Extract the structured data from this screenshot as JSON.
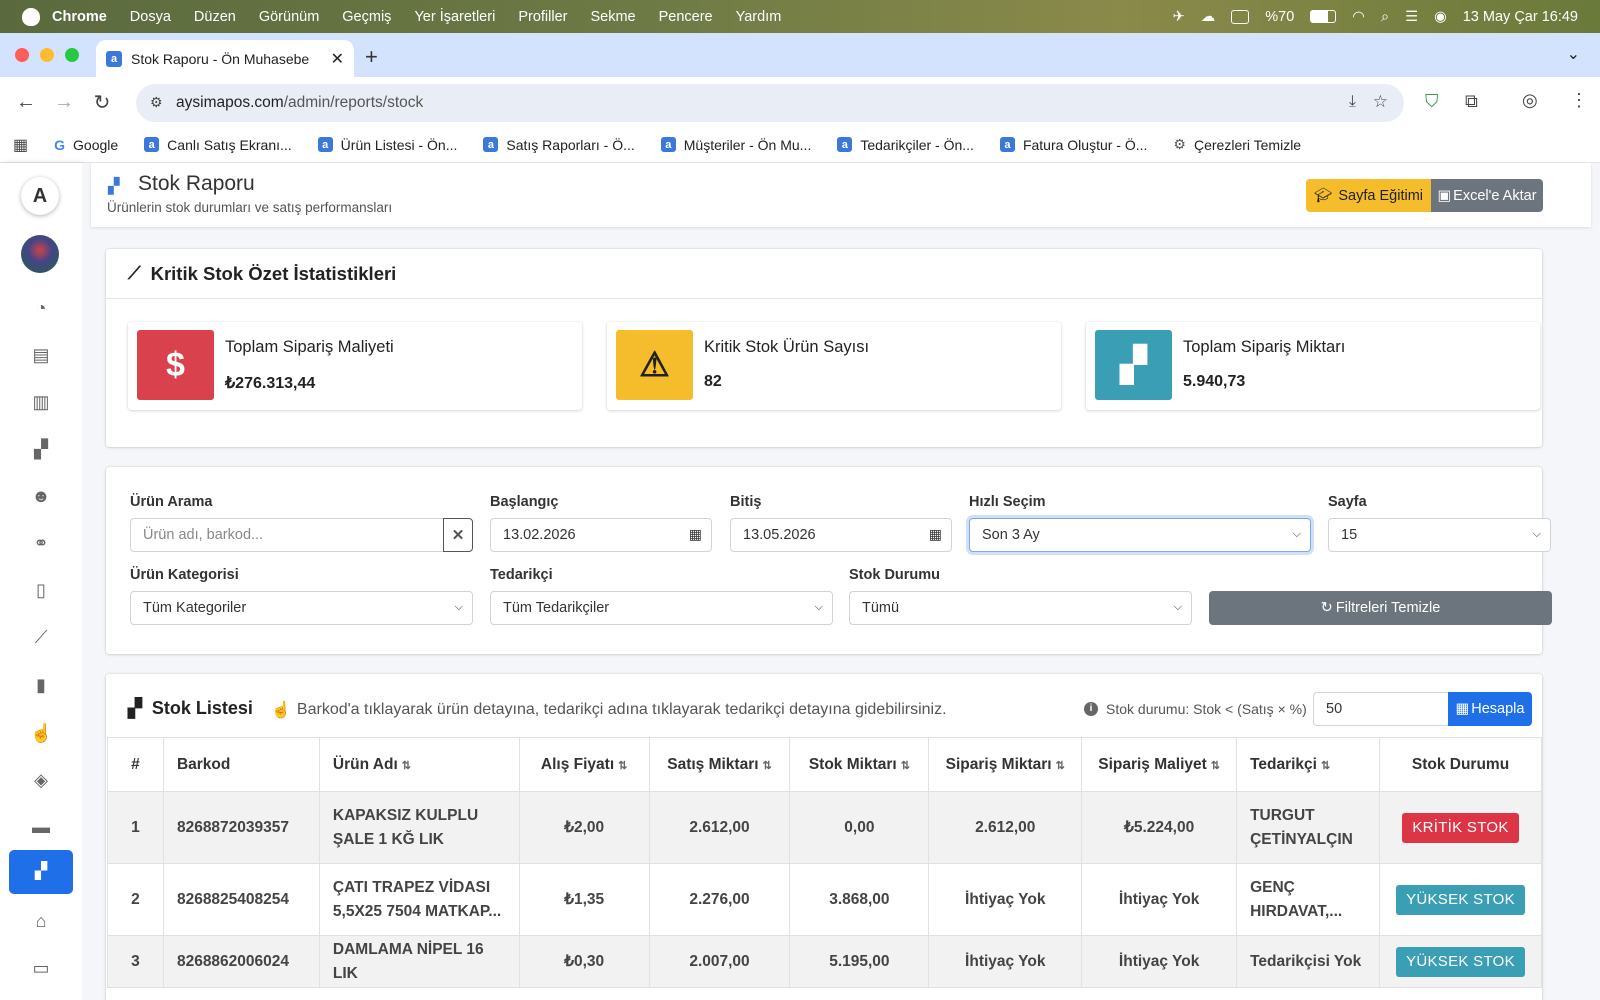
{
  "os_menubar": {
    "app": "Chrome",
    "items": [
      "Dosya",
      "Düzen",
      "Görünüm",
      "Geçmiş",
      "Yer İşaretleri",
      "Profiller",
      "Sekme",
      "Pencere",
      "Yardım"
    ],
    "battery": "%70",
    "datetime": "13 May Çar  16:49"
  },
  "browser": {
    "tab_title": "Stok Raporu - Ön Muhasebe",
    "url_host": "aysimapos.com",
    "url_path": "/admin/reports/stock",
    "bookmarks": [
      "Google",
      "Canlı Satış Ekranı...",
      "Ürün Listesi - Ön...",
      "Satış Raporları - Ö...",
      "Müşteriler - Ön Mu...",
      "Tedarikçiler - Ön...",
      "Fatura Oluştur - Ö...",
      "Çerezleri Temizle"
    ]
  },
  "header": {
    "title": "Stok Raporu",
    "subtitle": "Ürünlerin stok durumları ve satış performansları",
    "training_button": "Sayfa Eğitimi",
    "excel_button": "Excel'e Aktar"
  },
  "summary": {
    "title": "Kritik Stok Özet İstatistikleri",
    "boxes": [
      {
        "label": "Toplam Sipariş Maliyeti",
        "value": "₺276.313,44",
        "color": "#d9414d",
        "icon": "dollar-icon"
      },
      {
        "label": "Kritik Stok Ürün Sayısı",
        "value": "82",
        "color": "#f5bd2c",
        "icon": "warning-icon"
      },
      {
        "label": "Toplam Sipariş Miktarı",
        "value": "5.940,73",
        "color": "#3a9fb5",
        "icon": "boxes-icon"
      }
    ]
  },
  "filters": {
    "search_label": "Ürün Arama",
    "search_placeholder": "Ürün adı, barkod...",
    "start_label": "Başlangıç",
    "start_value": "13.02.2026",
    "end_label": "Bitiş",
    "end_value": "13.05.2026",
    "quick_label": "Hızlı Seçim",
    "quick_value": "Son 3 Ay",
    "page_label": "Sayfa",
    "page_value": "15",
    "category_label": "Ürün Kategorisi",
    "category_value": "Tüm Kategoriler",
    "supplier_label": "Tedarikçi",
    "supplier_value": "Tüm Tedarikçiler",
    "stock_label": "Stok Durumu",
    "stock_value": "Tümü",
    "clear_button": "Filtreleri Temizle"
  },
  "stock_list": {
    "title": "Stok Listesi",
    "hint": "Barkod'a tıklayarak ürün detayına, tedarikçi adına tıklayarak tedarikçi detayına gidebilirsiniz.",
    "formula_note": "Stok durumu: Stok < (Satış × %)",
    "percent_value": "50",
    "calc_button": "Hesapla",
    "columns": [
      "#",
      "Barkod",
      "Ürün Adı",
      "Alış Fiyatı",
      "Satış Miktarı",
      "Stok Miktarı",
      "Sipariş Miktarı",
      "Sipariş Maliyet",
      "Tedarikçi",
      "Stok Durumu"
    ],
    "rows": [
      {
        "no": "1",
        "barcode": "8268872039357",
        "name": "KAPAKSIZ KULPLU ŞALE 1 KĞ LIK",
        "buy": "₺2,00",
        "sales": "2.612,00",
        "stock": "0,00",
        "order_qty": "2.612,00",
        "order_cost": "₺5.224,00",
        "supplier": "TURGUT ÇETİNYALÇIN",
        "status": "KRİTİK STOK"
      },
      {
        "no": "2",
        "barcode": "8268825408254",
        "name": "ÇATI TRAPEZ VİDASI 5,5X25 7504 MATKAP...",
        "buy": "₺1,35",
        "sales": "2.276,00",
        "stock": "3.868,00",
        "order_qty": "İhtiyaç Yok",
        "order_cost": "İhtiyaç Yok",
        "supplier": "GENÇ HIRDAVAT,...",
        "status": "YÜKSEK STOK"
      },
      {
        "no": "3",
        "barcode": "8268862006024",
        "name": "DAMLAMA NİPEL 16 LIK",
        "buy": "₺0,30",
        "sales": "2.007,00",
        "stock": "5.195,00",
        "order_qty": "İhtiyaç Yok",
        "order_cost": "İhtiyaç Yok",
        "supplier": "Tedarikçisi Yok",
        "status": "YÜKSEK STOK"
      }
    ]
  }
}
